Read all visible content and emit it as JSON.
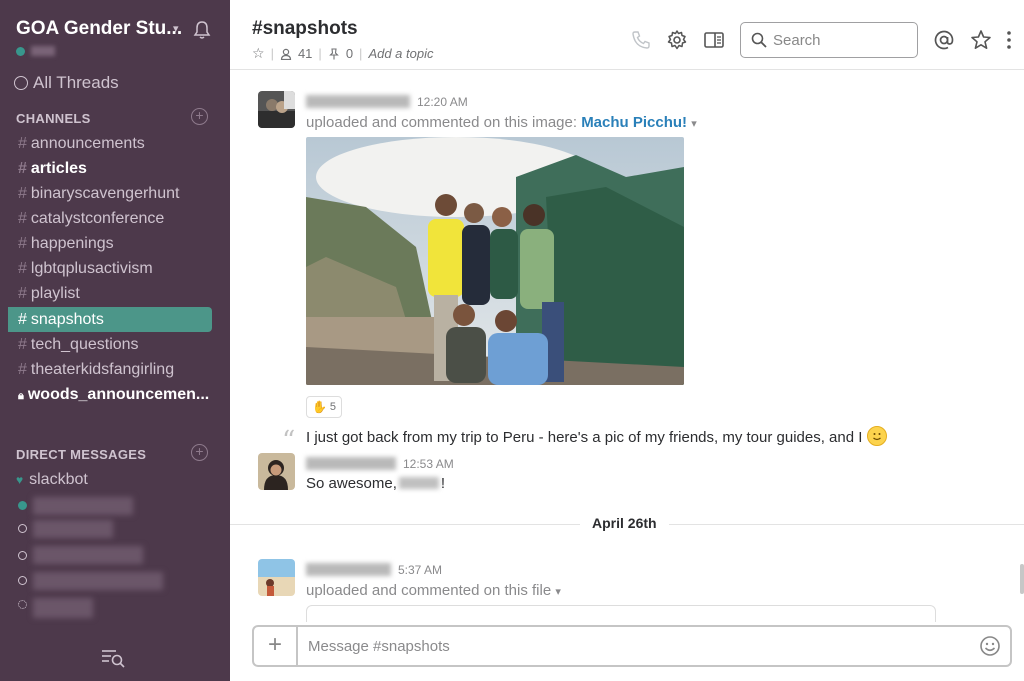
{
  "sidebar": {
    "team_name": "GOA Gender Stu...",
    "all_threads": "All Threads",
    "channels_header": "CHANNELS",
    "channels": [
      {
        "name": "announcements",
        "bold": false,
        "active": false
      },
      {
        "name": "articles",
        "bold": true,
        "active": false
      },
      {
        "name": "binaryscavengerhunt",
        "bold": false,
        "active": false
      },
      {
        "name": "catalystconference",
        "bold": false,
        "active": false
      },
      {
        "name": "happenings",
        "bold": false,
        "active": false
      },
      {
        "name": "lgbtqplusactivism",
        "bold": false,
        "active": false
      },
      {
        "name": "playlist",
        "bold": false,
        "active": false
      },
      {
        "name": "snapshots",
        "bold": false,
        "active": true
      },
      {
        "name": "tech_questions",
        "bold": false,
        "active": false
      },
      {
        "name": "theaterkidsfangirling",
        "bold": false,
        "active": false
      },
      {
        "name": "woods_announcemen...",
        "bold": true,
        "active": false,
        "private": true
      }
    ],
    "dm_header": "DIRECT MESSAGES",
    "dm_slackbot": "slackbot",
    "hash": "#"
  },
  "header": {
    "channel_name": "#snapshots",
    "member_count": "41",
    "pinned_count": "0",
    "topic_placeholder": "Add a topic",
    "search_placeholder": "Search"
  },
  "messages": {
    "m1": {
      "time": "12:20 AM",
      "action": "uploaded and commented on this image:",
      "image_title": "Machu Picchu!",
      "reaction_count": "5",
      "comment": "I just got back from my trip to Peru - here's a pic of my friends, my tour guides, and I"
    },
    "m2": {
      "time": "12:53 AM",
      "text_before": "So awesome,",
      "text_after": "!"
    },
    "day_divider": "April 26th",
    "m3": {
      "time": "5:37 AM",
      "action": "uploaded and commented on this file"
    }
  },
  "composer": {
    "placeholder": "Message #snapshots"
  },
  "colors": {
    "sidebar_bg": "#4d394b",
    "active_channel": "#4c9689",
    "link": "#2a80b9",
    "presence_online": "#38978d"
  }
}
